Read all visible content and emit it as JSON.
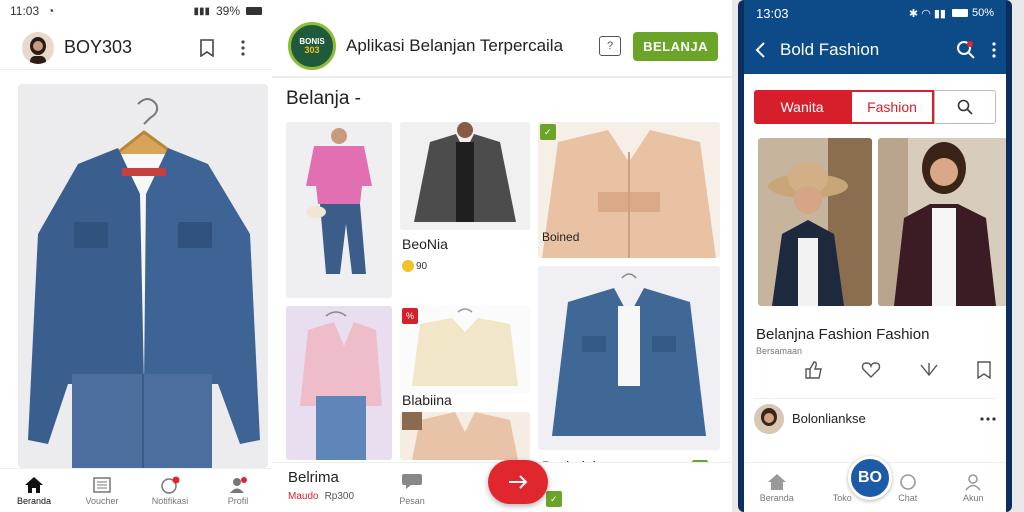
{
  "left": {
    "status": {
      "time": "11:03",
      "battery": "39%"
    },
    "header": {
      "username": "BOY303"
    },
    "nav": [
      {
        "label": "Beranda",
        "icon": "home-icon"
      },
      {
        "label": "Voucher",
        "icon": "list-icon"
      },
      {
        "label": "Notifikasi",
        "icon": "bell-icon",
        "badge": ""
      },
      {
        "label": "Profil",
        "icon": "user-icon"
      }
    ]
  },
  "mid": {
    "header": {
      "logo_top": "BONIS",
      "logo_bottom": "303",
      "title": "Aplikasi Belanjan Terpercaila",
      "cta": "BELANJA"
    },
    "section_title": "Belanja -",
    "products": [
      {
        "label": "",
        "price": ""
      },
      {
        "label": "BeoNia",
        "price": "90"
      },
      {
        "label": "Boined",
        "price": ""
      },
      {
        "label": "",
        "price": ""
      },
      {
        "label": "Blabiina",
        "price": ""
      },
      {
        "label": "",
        "price": ""
      },
      {
        "label": "Bashajah",
        "price": ""
      },
      {
        "label": "Belrima",
        "price": "Rp300",
        "sub": "Maudo"
      }
    ],
    "bottom_nav": [
      {
        "label": "Pesan"
      }
    ]
  },
  "right": {
    "status": {
      "time": "13:03",
      "battery": "50%"
    },
    "appbar": {
      "title": "Bold Fashion"
    },
    "tabs": {
      "first": "Wanita",
      "second": "Fashion"
    },
    "post": {
      "title": "Belanjna Fashion Fashion",
      "subtitle": "Bersamaan",
      "user": "Bolonliankse"
    },
    "fab": "BO",
    "nav": [
      {
        "label": "Beranda"
      },
      {
        "label": "Toko"
      },
      {
        "label": "Chat"
      },
      {
        "label": "Akun"
      }
    ]
  },
  "colors": {
    "green": "#6aa52a",
    "red": "#d71f2b",
    "navy": "#0d4a88"
  }
}
